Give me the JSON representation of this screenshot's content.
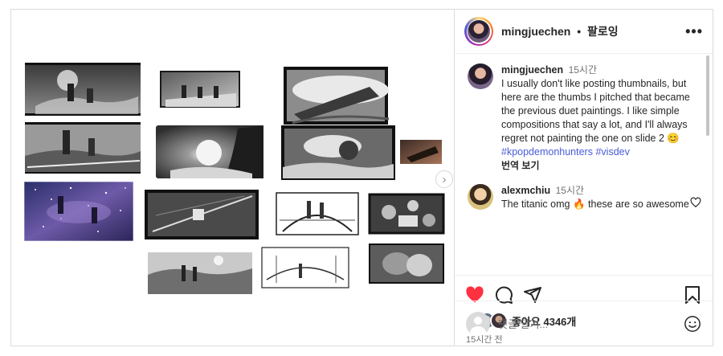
{
  "header": {
    "username": "mingjuechen",
    "separator": "•",
    "follow_label": "팔로잉",
    "more_icon": "more-horizontal-icon"
  },
  "caption": {
    "username": "mingjuechen",
    "time": "15시간",
    "text": "I usually don't like posting thumbnails, but here are the thumbs I pitched that became the previous duet paintings. I like simple compositions that say a lot, and I'll always regret not painting the one on slide 2",
    "emoji": "😊",
    "hashtags": [
      "#kpopdemonhunters",
      "#visdev"
    ],
    "translate_label": "번역 보기"
  },
  "comments": [
    {
      "username": "alexmchiu",
      "time": "15시간",
      "text_before": "The titanic omg",
      "emoji": "🔥",
      "text_after": "these are so awesome"
    }
  ],
  "actions": {
    "liked": true,
    "accent_color": "#ff3040",
    "like_icon": "heart-filled-icon",
    "comment_icon": "comment-icon",
    "share_icon": "share-icon",
    "save_icon": "bookmark-icon"
  },
  "likes": {
    "text": "좋아요 4346개"
  },
  "posted_ago": "15시간 전",
  "add_comment": {
    "placeholder": "댓글 달기...",
    "emoji_icon": "smiley-icon"
  },
  "carousel": {
    "next_icon": "chevron-right-icon"
  }
}
